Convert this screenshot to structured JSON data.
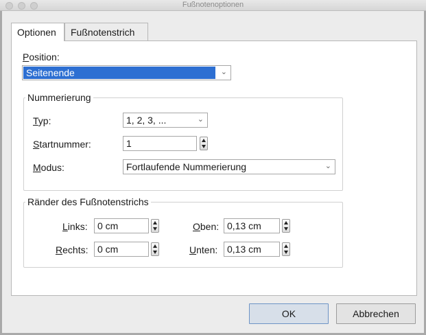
{
  "window": {
    "title": "Fußnotenoptionen"
  },
  "tabs": [
    {
      "label": "Optionen",
      "active": true
    },
    {
      "label": "Fußnotenstrich",
      "active": false
    }
  ],
  "position": {
    "label_u": "P",
    "label_rest": "osition:",
    "value": "Seitenende"
  },
  "numbering": {
    "legend": "Nummerierung",
    "type": {
      "label_u": "T",
      "label_rest": "yp:",
      "value": "1, 2, 3, ..."
    },
    "start": {
      "label_u": "S",
      "label_rest": "tartnummer:",
      "value": "1"
    },
    "mode": {
      "label_u": "M",
      "label_rest": "odus:",
      "value": "Fortlaufende Nummerierung"
    }
  },
  "margins": {
    "legend": "Ränder des Fußnotenstrichs",
    "left": {
      "label_u": "L",
      "label_rest": "inks:",
      "value": "0 cm"
    },
    "right": {
      "label_u": "R",
      "label_rest": "echts:",
      "value": "0 cm"
    },
    "top": {
      "label_u": "O",
      "label_rest": "ben:",
      "value": "0,13 cm"
    },
    "bottom": {
      "label_u": "U",
      "label_rest": "nten:",
      "value": "0,13 cm"
    }
  },
  "buttons": {
    "ok": "OK",
    "cancel": "Abbrechen"
  },
  "colors": {
    "selection": "#2d6fd2",
    "default_button": "#d7dfe9"
  },
  "icons": {
    "chevron": "chevron-down-icon",
    "stepper": "stepper-arrows-icon"
  }
}
